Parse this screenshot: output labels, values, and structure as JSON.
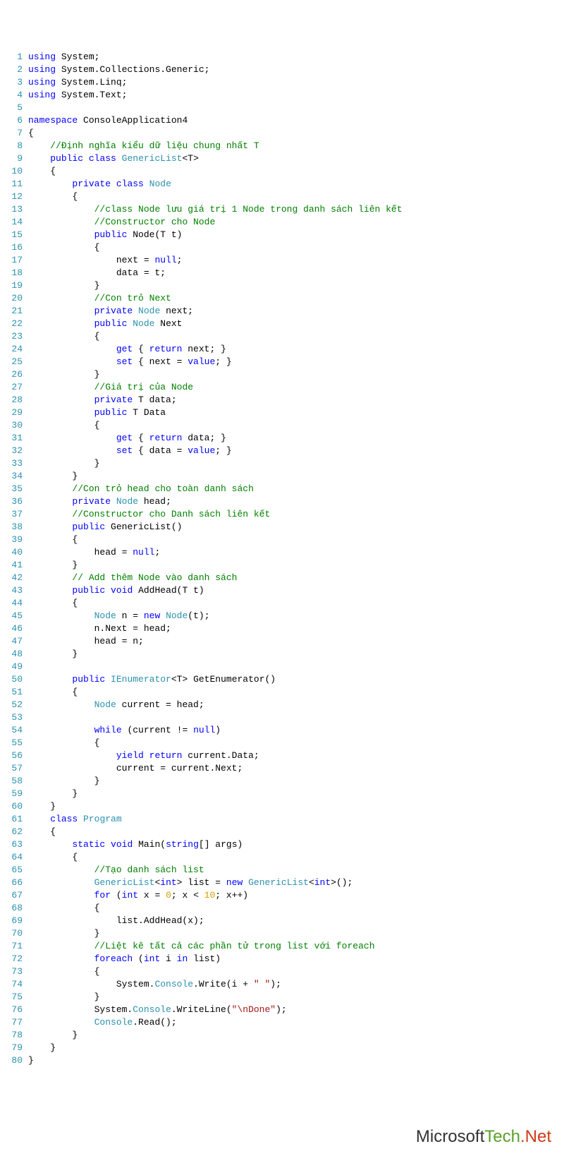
{
  "watermark": {
    "part1": "Microsoft",
    "part2": "Tech",
    "dot": ".",
    "part3": "Net"
  },
  "lines": [
    {
      "n": 1,
      "segs": [
        {
          "c": "kw",
          "t": "using"
        },
        {
          "c": "txt",
          "t": " System;"
        }
      ]
    },
    {
      "n": 2,
      "segs": [
        {
          "c": "kw",
          "t": "using"
        },
        {
          "c": "txt",
          "t": " System.Collections.Generic;"
        }
      ]
    },
    {
      "n": 3,
      "segs": [
        {
          "c": "kw",
          "t": "using"
        },
        {
          "c": "txt",
          "t": " System.Linq;"
        }
      ]
    },
    {
      "n": 4,
      "segs": [
        {
          "c": "kw",
          "t": "using"
        },
        {
          "c": "txt",
          "t": " System.Text;"
        }
      ]
    },
    {
      "n": 5,
      "segs": [
        {
          "c": "txt",
          "t": ""
        }
      ]
    },
    {
      "n": 6,
      "segs": [
        {
          "c": "kw",
          "t": "namespace"
        },
        {
          "c": "txt",
          "t": " ConsoleApplication4"
        }
      ]
    },
    {
      "n": 7,
      "segs": [
        {
          "c": "txt",
          "t": "{"
        }
      ]
    },
    {
      "n": 8,
      "segs": [
        {
          "c": "txt",
          "t": "    "
        },
        {
          "c": "cmt",
          "t": "//Định nghĩa kiểu dữ liệu chung nhất T"
        }
      ]
    },
    {
      "n": 9,
      "segs": [
        {
          "c": "txt",
          "t": "    "
        },
        {
          "c": "kw",
          "t": "public"
        },
        {
          "c": "txt",
          "t": " "
        },
        {
          "c": "kw",
          "t": "class"
        },
        {
          "c": "txt",
          "t": " "
        },
        {
          "c": "type",
          "t": "GenericList"
        },
        {
          "c": "txt",
          "t": "<T>"
        }
      ]
    },
    {
      "n": 10,
      "segs": [
        {
          "c": "txt",
          "t": "    {"
        }
      ]
    },
    {
      "n": 11,
      "segs": [
        {
          "c": "txt",
          "t": "        "
        },
        {
          "c": "kw",
          "t": "private"
        },
        {
          "c": "txt",
          "t": " "
        },
        {
          "c": "kw",
          "t": "class"
        },
        {
          "c": "txt",
          "t": " "
        },
        {
          "c": "type",
          "t": "Node"
        }
      ]
    },
    {
      "n": 12,
      "segs": [
        {
          "c": "txt",
          "t": "        {"
        }
      ]
    },
    {
      "n": 13,
      "segs": [
        {
          "c": "txt",
          "t": "            "
        },
        {
          "c": "cmt",
          "t": "//class Node lưu giá trị 1 Node trong danh sách liên kết"
        }
      ]
    },
    {
      "n": 14,
      "segs": [
        {
          "c": "txt",
          "t": "            "
        },
        {
          "c": "cmt",
          "t": "//Constructor cho Node"
        }
      ]
    },
    {
      "n": 15,
      "segs": [
        {
          "c": "txt",
          "t": "            "
        },
        {
          "c": "kw",
          "t": "public"
        },
        {
          "c": "txt",
          "t": " Node(T t)"
        }
      ]
    },
    {
      "n": 16,
      "segs": [
        {
          "c": "txt",
          "t": "            {"
        }
      ]
    },
    {
      "n": 17,
      "segs": [
        {
          "c": "txt",
          "t": "                next = "
        },
        {
          "c": "kw",
          "t": "null"
        },
        {
          "c": "txt",
          "t": ";"
        }
      ]
    },
    {
      "n": 18,
      "segs": [
        {
          "c": "txt",
          "t": "                data = t;"
        }
      ]
    },
    {
      "n": 19,
      "segs": [
        {
          "c": "txt",
          "t": "            }"
        }
      ]
    },
    {
      "n": 20,
      "segs": [
        {
          "c": "txt",
          "t": "            "
        },
        {
          "c": "cmt",
          "t": "//Con trỏ Next"
        }
      ]
    },
    {
      "n": 21,
      "segs": [
        {
          "c": "txt",
          "t": "            "
        },
        {
          "c": "kw",
          "t": "private"
        },
        {
          "c": "txt",
          "t": " "
        },
        {
          "c": "type",
          "t": "Node"
        },
        {
          "c": "txt",
          "t": " next;"
        }
      ]
    },
    {
      "n": 22,
      "segs": [
        {
          "c": "txt",
          "t": "            "
        },
        {
          "c": "kw",
          "t": "public"
        },
        {
          "c": "txt",
          "t": " "
        },
        {
          "c": "type",
          "t": "Node"
        },
        {
          "c": "txt",
          "t": " Next"
        }
      ]
    },
    {
      "n": 23,
      "segs": [
        {
          "c": "txt",
          "t": "            {"
        }
      ]
    },
    {
      "n": 24,
      "segs": [
        {
          "c": "txt",
          "t": "                "
        },
        {
          "c": "kw",
          "t": "get"
        },
        {
          "c": "txt",
          "t": " { "
        },
        {
          "c": "kw",
          "t": "return"
        },
        {
          "c": "txt",
          "t": " next; }"
        }
      ]
    },
    {
      "n": 25,
      "segs": [
        {
          "c": "txt",
          "t": "                "
        },
        {
          "c": "kw",
          "t": "set"
        },
        {
          "c": "txt",
          "t": " { next = "
        },
        {
          "c": "kw",
          "t": "value"
        },
        {
          "c": "txt",
          "t": "; }"
        }
      ]
    },
    {
      "n": 26,
      "segs": [
        {
          "c": "txt",
          "t": "            }"
        }
      ]
    },
    {
      "n": 27,
      "segs": [
        {
          "c": "txt",
          "t": "            "
        },
        {
          "c": "cmt",
          "t": "//Giá trị của Node"
        }
      ]
    },
    {
      "n": 28,
      "segs": [
        {
          "c": "txt",
          "t": "            "
        },
        {
          "c": "kw",
          "t": "private"
        },
        {
          "c": "txt",
          "t": " T data;"
        }
      ]
    },
    {
      "n": 29,
      "segs": [
        {
          "c": "txt",
          "t": "            "
        },
        {
          "c": "kw",
          "t": "public"
        },
        {
          "c": "txt",
          "t": " T Data"
        }
      ]
    },
    {
      "n": 30,
      "segs": [
        {
          "c": "txt",
          "t": "            {"
        }
      ]
    },
    {
      "n": 31,
      "segs": [
        {
          "c": "txt",
          "t": "                "
        },
        {
          "c": "kw",
          "t": "get"
        },
        {
          "c": "txt",
          "t": " { "
        },
        {
          "c": "kw",
          "t": "return"
        },
        {
          "c": "txt",
          "t": " data; }"
        }
      ]
    },
    {
      "n": 32,
      "segs": [
        {
          "c": "txt",
          "t": "                "
        },
        {
          "c": "kw",
          "t": "set"
        },
        {
          "c": "txt",
          "t": " { data = "
        },
        {
          "c": "kw",
          "t": "value"
        },
        {
          "c": "txt",
          "t": "; }"
        }
      ]
    },
    {
      "n": 33,
      "segs": [
        {
          "c": "txt",
          "t": "            }"
        }
      ]
    },
    {
      "n": 34,
      "segs": [
        {
          "c": "txt",
          "t": "        }"
        }
      ]
    },
    {
      "n": 35,
      "segs": [
        {
          "c": "txt",
          "t": "        "
        },
        {
          "c": "cmt",
          "t": "//Con trỏ head cho toàn danh sách"
        }
      ]
    },
    {
      "n": 36,
      "segs": [
        {
          "c": "txt",
          "t": "        "
        },
        {
          "c": "kw",
          "t": "private"
        },
        {
          "c": "txt",
          "t": " "
        },
        {
          "c": "type",
          "t": "Node"
        },
        {
          "c": "txt",
          "t": " head;"
        }
      ]
    },
    {
      "n": 37,
      "segs": [
        {
          "c": "txt",
          "t": "        "
        },
        {
          "c": "cmt",
          "t": "//Constructor cho Danh sách liên kết"
        }
      ]
    },
    {
      "n": 38,
      "segs": [
        {
          "c": "txt",
          "t": "        "
        },
        {
          "c": "kw",
          "t": "public"
        },
        {
          "c": "txt",
          "t": " GenericList()"
        }
      ]
    },
    {
      "n": 39,
      "segs": [
        {
          "c": "txt",
          "t": "        {"
        }
      ]
    },
    {
      "n": 40,
      "segs": [
        {
          "c": "txt",
          "t": "            head = "
        },
        {
          "c": "kw",
          "t": "null"
        },
        {
          "c": "txt",
          "t": ";"
        }
      ]
    },
    {
      "n": 41,
      "segs": [
        {
          "c": "txt",
          "t": "        }"
        }
      ]
    },
    {
      "n": 42,
      "segs": [
        {
          "c": "txt",
          "t": "        "
        },
        {
          "c": "cmt",
          "t": "// Add thêm Node vào danh sách"
        }
      ]
    },
    {
      "n": 43,
      "segs": [
        {
          "c": "txt",
          "t": "        "
        },
        {
          "c": "kw",
          "t": "public"
        },
        {
          "c": "txt",
          "t": " "
        },
        {
          "c": "kw",
          "t": "void"
        },
        {
          "c": "txt",
          "t": " AddHead(T t)"
        }
      ]
    },
    {
      "n": 44,
      "segs": [
        {
          "c": "txt",
          "t": "        {"
        }
      ]
    },
    {
      "n": 45,
      "segs": [
        {
          "c": "txt",
          "t": "            "
        },
        {
          "c": "type",
          "t": "Node"
        },
        {
          "c": "txt",
          "t": " n = "
        },
        {
          "c": "kw",
          "t": "new"
        },
        {
          "c": "txt",
          "t": " "
        },
        {
          "c": "type",
          "t": "Node"
        },
        {
          "c": "txt",
          "t": "(t);"
        }
      ]
    },
    {
      "n": 46,
      "segs": [
        {
          "c": "txt",
          "t": "            n.Next = head;"
        }
      ]
    },
    {
      "n": 47,
      "segs": [
        {
          "c": "txt",
          "t": "            head = n;"
        }
      ]
    },
    {
      "n": 48,
      "segs": [
        {
          "c": "txt",
          "t": "        }"
        }
      ]
    },
    {
      "n": 49,
      "segs": [
        {
          "c": "txt",
          "t": ""
        }
      ]
    },
    {
      "n": 50,
      "segs": [
        {
          "c": "txt",
          "t": "        "
        },
        {
          "c": "kw",
          "t": "public"
        },
        {
          "c": "txt",
          "t": " "
        },
        {
          "c": "type",
          "t": "IEnumerator"
        },
        {
          "c": "txt",
          "t": "<T> GetEnumerator()"
        }
      ]
    },
    {
      "n": 51,
      "segs": [
        {
          "c": "txt",
          "t": "        {"
        }
      ]
    },
    {
      "n": 52,
      "segs": [
        {
          "c": "txt",
          "t": "            "
        },
        {
          "c": "type",
          "t": "Node"
        },
        {
          "c": "txt",
          "t": " current = head;"
        }
      ]
    },
    {
      "n": 53,
      "segs": [
        {
          "c": "txt",
          "t": ""
        }
      ]
    },
    {
      "n": 54,
      "segs": [
        {
          "c": "txt",
          "t": "            "
        },
        {
          "c": "kw",
          "t": "while"
        },
        {
          "c": "txt",
          "t": " (current != "
        },
        {
          "c": "kw",
          "t": "null"
        },
        {
          "c": "txt",
          "t": ")"
        }
      ]
    },
    {
      "n": 55,
      "segs": [
        {
          "c": "txt",
          "t": "            {"
        }
      ]
    },
    {
      "n": 56,
      "segs": [
        {
          "c": "txt",
          "t": "                "
        },
        {
          "c": "kw",
          "t": "yield"
        },
        {
          "c": "txt",
          "t": " "
        },
        {
          "c": "kw",
          "t": "return"
        },
        {
          "c": "txt",
          "t": " current.Data;"
        }
      ]
    },
    {
      "n": 57,
      "segs": [
        {
          "c": "txt",
          "t": "                current = current.Next;"
        }
      ]
    },
    {
      "n": 58,
      "segs": [
        {
          "c": "txt",
          "t": "            }"
        }
      ]
    },
    {
      "n": 59,
      "segs": [
        {
          "c": "txt",
          "t": "        }"
        }
      ]
    },
    {
      "n": 60,
      "segs": [
        {
          "c": "txt",
          "t": "    }"
        }
      ]
    },
    {
      "n": 61,
      "segs": [
        {
          "c": "txt",
          "t": "    "
        },
        {
          "c": "kw",
          "t": "class"
        },
        {
          "c": "txt",
          "t": " "
        },
        {
          "c": "type",
          "t": "Program"
        }
      ]
    },
    {
      "n": 62,
      "segs": [
        {
          "c": "txt",
          "t": "    {"
        }
      ]
    },
    {
      "n": 63,
      "segs": [
        {
          "c": "txt",
          "t": "        "
        },
        {
          "c": "kw",
          "t": "static"
        },
        {
          "c": "txt",
          "t": " "
        },
        {
          "c": "kw",
          "t": "void"
        },
        {
          "c": "txt",
          "t": " Main("
        },
        {
          "c": "kw",
          "t": "string"
        },
        {
          "c": "txt",
          "t": "[] args)"
        }
      ]
    },
    {
      "n": 64,
      "segs": [
        {
          "c": "txt",
          "t": "        {"
        }
      ]
    },
    {
      "n": 65,
      "segs": [
        {
          "c": "txt",
          "t": "            "
        },
        {
          "c": "cmt",
          "t": "//Tạo danh sách list"
        }
      ]
    },
    {
      "n": 66,
      "segs": [
        {
          "c": "txt",
          "t": "            "
        },
        {
          "c": "type",
          "t": "GenericList"
        },
        {
          "c": "txt",
          "t": "<"
        },
        {
          "c": "kw",
          "t": "int"
        },
        {
          "c": "txt",
          "t": "> list = "
        },
        {
          "c": "kw",
          "t": "new"
        },
        {
          "c": "txt",
          "t": " "
        },
        {
          "c": "type",
          "t": "GenericList"
        },
        {
          "c": "txt",
          "t": "<"
        },
        {
          "c": "kw",
          "t": "int"
        },
        {
          "c": "txt",
          "t": ">();"
        }
      ]
    },
    {
      "n": 67,
      "segs": [
        {
          "c": "txt",
          "t": "            "
        },
        {
          "c": "kw",
          "t": "for"
        },
        {
          "c": "txt",
          "t": " ("
        },
        {
          "c": "kw",
          "t": "int"
        },
        {
          "c": "txt",
          "t": " x = "
        },
        {
          "c": "num",
          "t": "0"
        },
        {
          "c": "txt",
          "t": "; x < "
        },
        {
          "c": "num",
          "t": "10"
        },
        {
          "c": "txt",
          "t": "; x++)"
        }
      ]
    },
    {
      "n": 68,
      "segs": [
        {
          "c": "txt",
          "t": "            {"
        }
      ]
    },
    {
      "n": 69,
      "segs": [
        {
          "c": "txt",
          "t": "                list.AddHead(x);"
        }
      ]
    },
    {
      "n": 70,
      "segs": [
        {
          "c": "txt",
          "t": "            }"
        }
      ]
    },
    {
      "n": 71,
      "segs": [
        {
          "c": "txt",
          "t": "            "
        },
        {
          "c": "cmt",
          "t": "//Liệt kê tất cả các phần tử trong list với foreach"
        }
      ]
    },
    {
      "n": 72,
      "segs": [
        {
          "c": "txt",
          "t": "            "
        },
        {
          "c": "kw",
          "t": "foreach"
        },
        {
          "c": "txt",
          "t": " ("
        },
        {
          "c": "kw",
          "t": "int"
        },
        {
          "c": "txt",
          "t": " i "
        },
        {
          "c": "kw",
          "t": "in"
        },
        {
          "c": "txt",
          "t": " list)"
        }
      ]
    },
    {
      "n": 73,
      "segs": [
        {
          "c": "txt",
          "t": "            {"
        }
      ]
    },
    {
      "n": 74,
      "segs": [
        {
          "c": "txt",
          "t": "                System."
        },
        {
          "c": "type",
          "t": "Console"
        },
        {
          "c": "txt",
          "t": ".Write(i + "
        },
        {
          "c": "str",
          "t": "\" \""
        },
        {
          "c": "txt",
          "t": ");"
        }
      ]
    },
    {
      "n": 75,
      "segs": [
        {
          "c": "txt",
          "t": "            }"
        }
      ]
    },
    {
      "n": 76,
      "segs": [
        {
          "c": "txt",
          "t": "            System."
        },
        {
          "c": "type",
          "t": "Console"
        },
        {
          "c": "txt",
          "t": ".WriteLine("
        },
        {
          "c": "str",
          "t": "\"\\nDone\""
        },
        {
          "c": "txt",
          "t": ");"
        }
      ]
    },
    {
      "n": 77,
      "segs": [
        {
          "c": "txt",
          "t": "            "
        },
        {
          "c": "type",
          "t": "Console"
        },
        {
          "c": "txt",
          "t": ".Read();"
        }
      ]
    },
    {
      "n": 78,
      "segs": [
        {
          "c": "txt",
          "t": "        }"
        }
      ]
    },
    {
      "n": 79,
      "segs": [
        {
          "c": "txt",
          "t": "    }"
        }
      ]
    },
    {
      "n": 80,
      "segs": [
        {
          "c": "txt",
          "t": "}"
        }
      ]
    }
  ]
}
